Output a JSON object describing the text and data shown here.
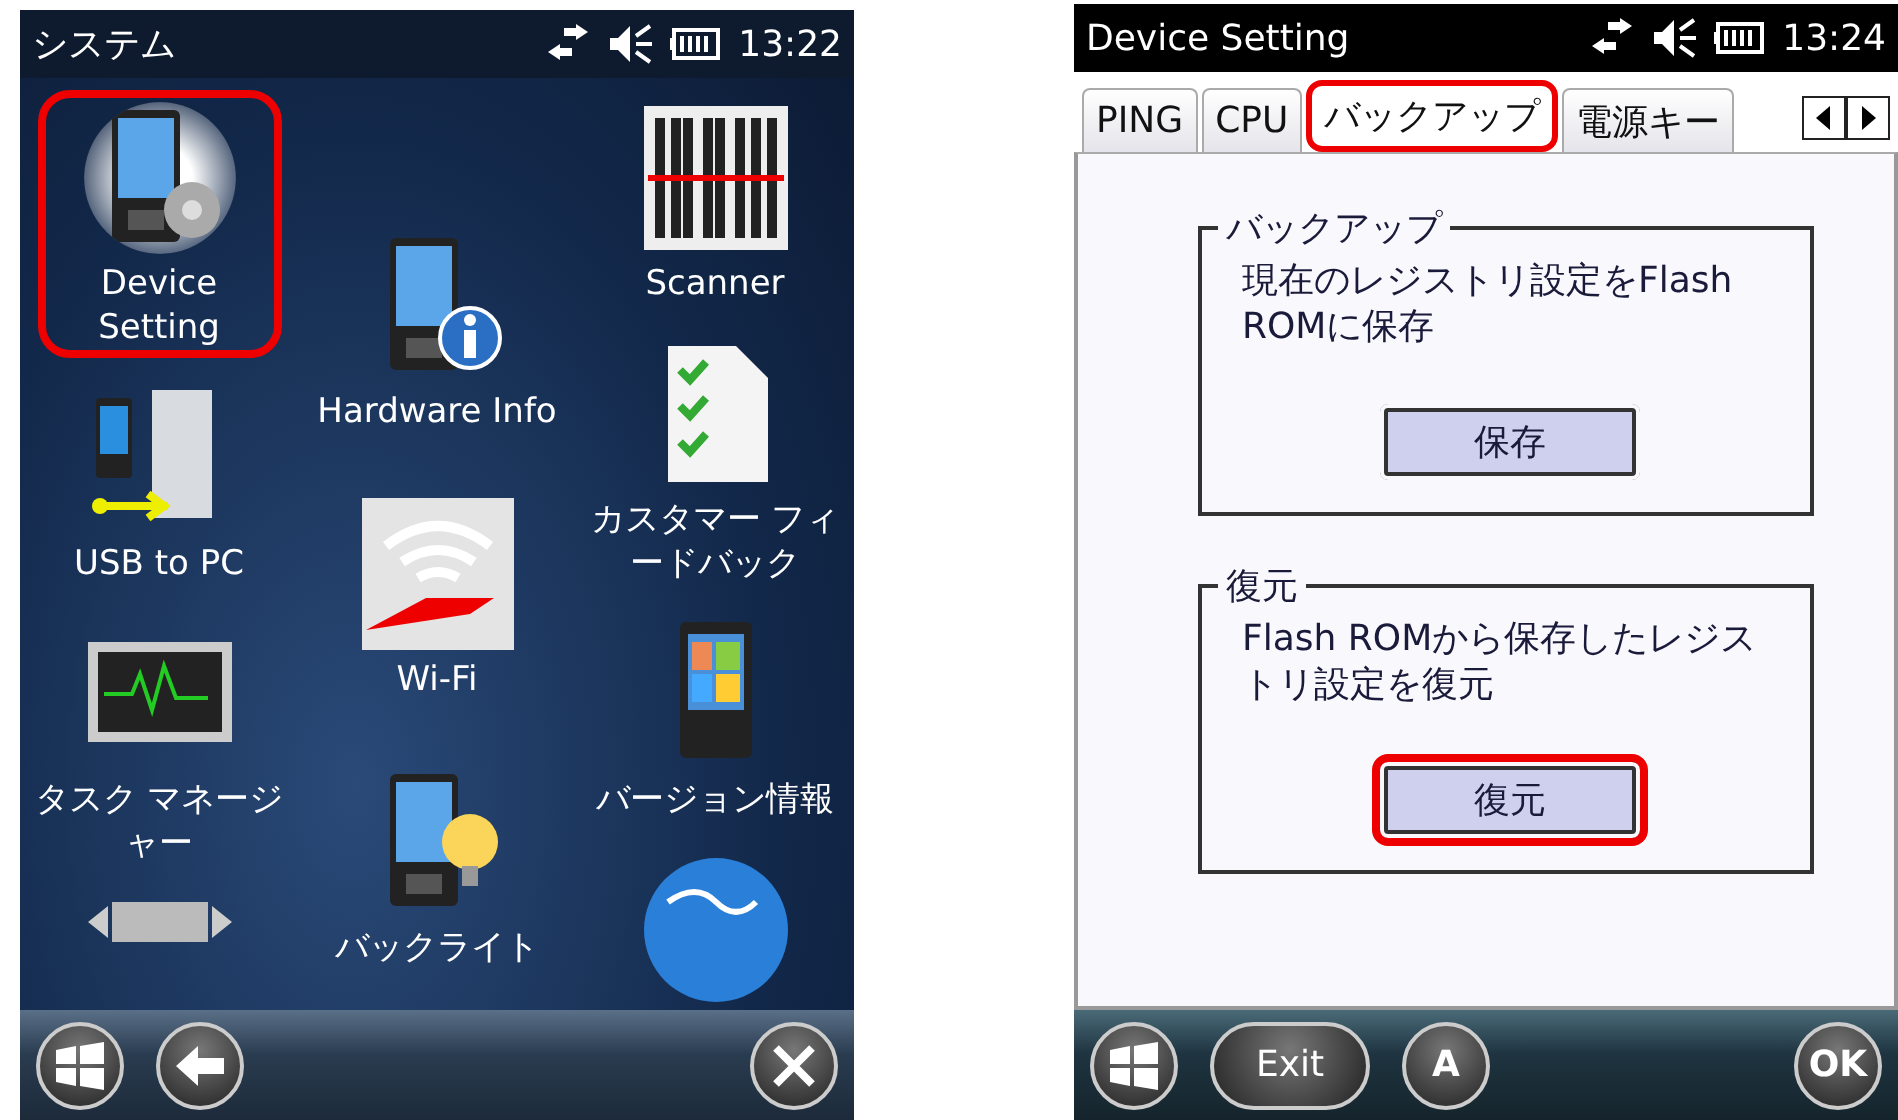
{
  "left_screen": {
    "status_bar": {
      "title": "システム",
      "time": "13:22"
    },
    "icon_columns": [
      [
        {
          "kind": "device-setting",
          "label": "Device Setting",
          "selected": true,
          "highlighted": true
        },
        {
          "kind": "usb",
          "label": "USB to PC",
          "selected": false,
          "highlighted": false
        },
        {
          "kind": "task-manager",
          "label": "タスク マネージャー",
          "selected": false,
          "highlighted": false
        },
        {
          "kind": "printer",
          "selected": false,
          "highlighted": false
        }
      ],
      [
        {
          "kind": "hardware-info",
          "label": "Hardware Info",
          "selected": false,
          "highlighted": false
        },
        {
          "kind": "wifi",
          "label": "Wi-Fi",
          "selected": false,
          "highlighted": false
        },
        {
          "kind": "backlight",
          "label": "バックライト",
          "selected": false,
          "highlighted": false
        }
      ],
      [
        {
          "kind": "scanner",
          "label": "Scanner",
          "selected": false,
          "highlighted": false
        },
        {
          "kind": "feedback",
          "label": "カスタマー フィードバック",
          "selected": false,
          "highlighted": false
        },
        {
          "kind": "version",
          "label": "バージョン情報",
          "selected": false,
          "highlighted": false
        },
        {
          "kind": "globe",
          "selected": false,
          "highlighted": false
        }
      ]
    ],
    "bottom_bar": [
      {
        "kind": "windows"
      },
      {
        "kind": "back"
      },
      {
        "kind": "close"
      }
    ]
  },
  "right_screen": {
    "status_bar": {
      "title": "Device Setting",
      "time": "13:24"
    },
    "tabs": [
      {
        "label": "PING",
        "selected": false,
        "highlighted": false
      },
      {
        "label": "CPU",
        "selected": false,
        "highlighted": false
      },
      {
        "label": "バックアップ",
        "selected": true,
        "highlighted": true
      },
      {
        "label": "電源キー",
        "selected": false,
        "highlighted": false
      }
    ],
    "groups": [
      {
        "title": "バックアップ",
        "text": "現在のレジストリ設定をFlash ROMに保存",
        "button": {
          "label": "保存",
          "highlighted": false
        }
      },
      {
        "title": "復元",
        "text": "Flash ROMから保存したレジストリ設定を復元",
        "button": {
          "label": "復元",
          "highlighted": true
        }
      }
    ],
    "bottom_bar": [
      {
        "kind": "windows"
      },
      {
        "kind": "pill",
        "label": "Exit"
      },
      {
        "kind": "round",
        "label": "A"
      },
      {
        "kind": "round",
        "label": "OK"
      }
    ]
  }
}
